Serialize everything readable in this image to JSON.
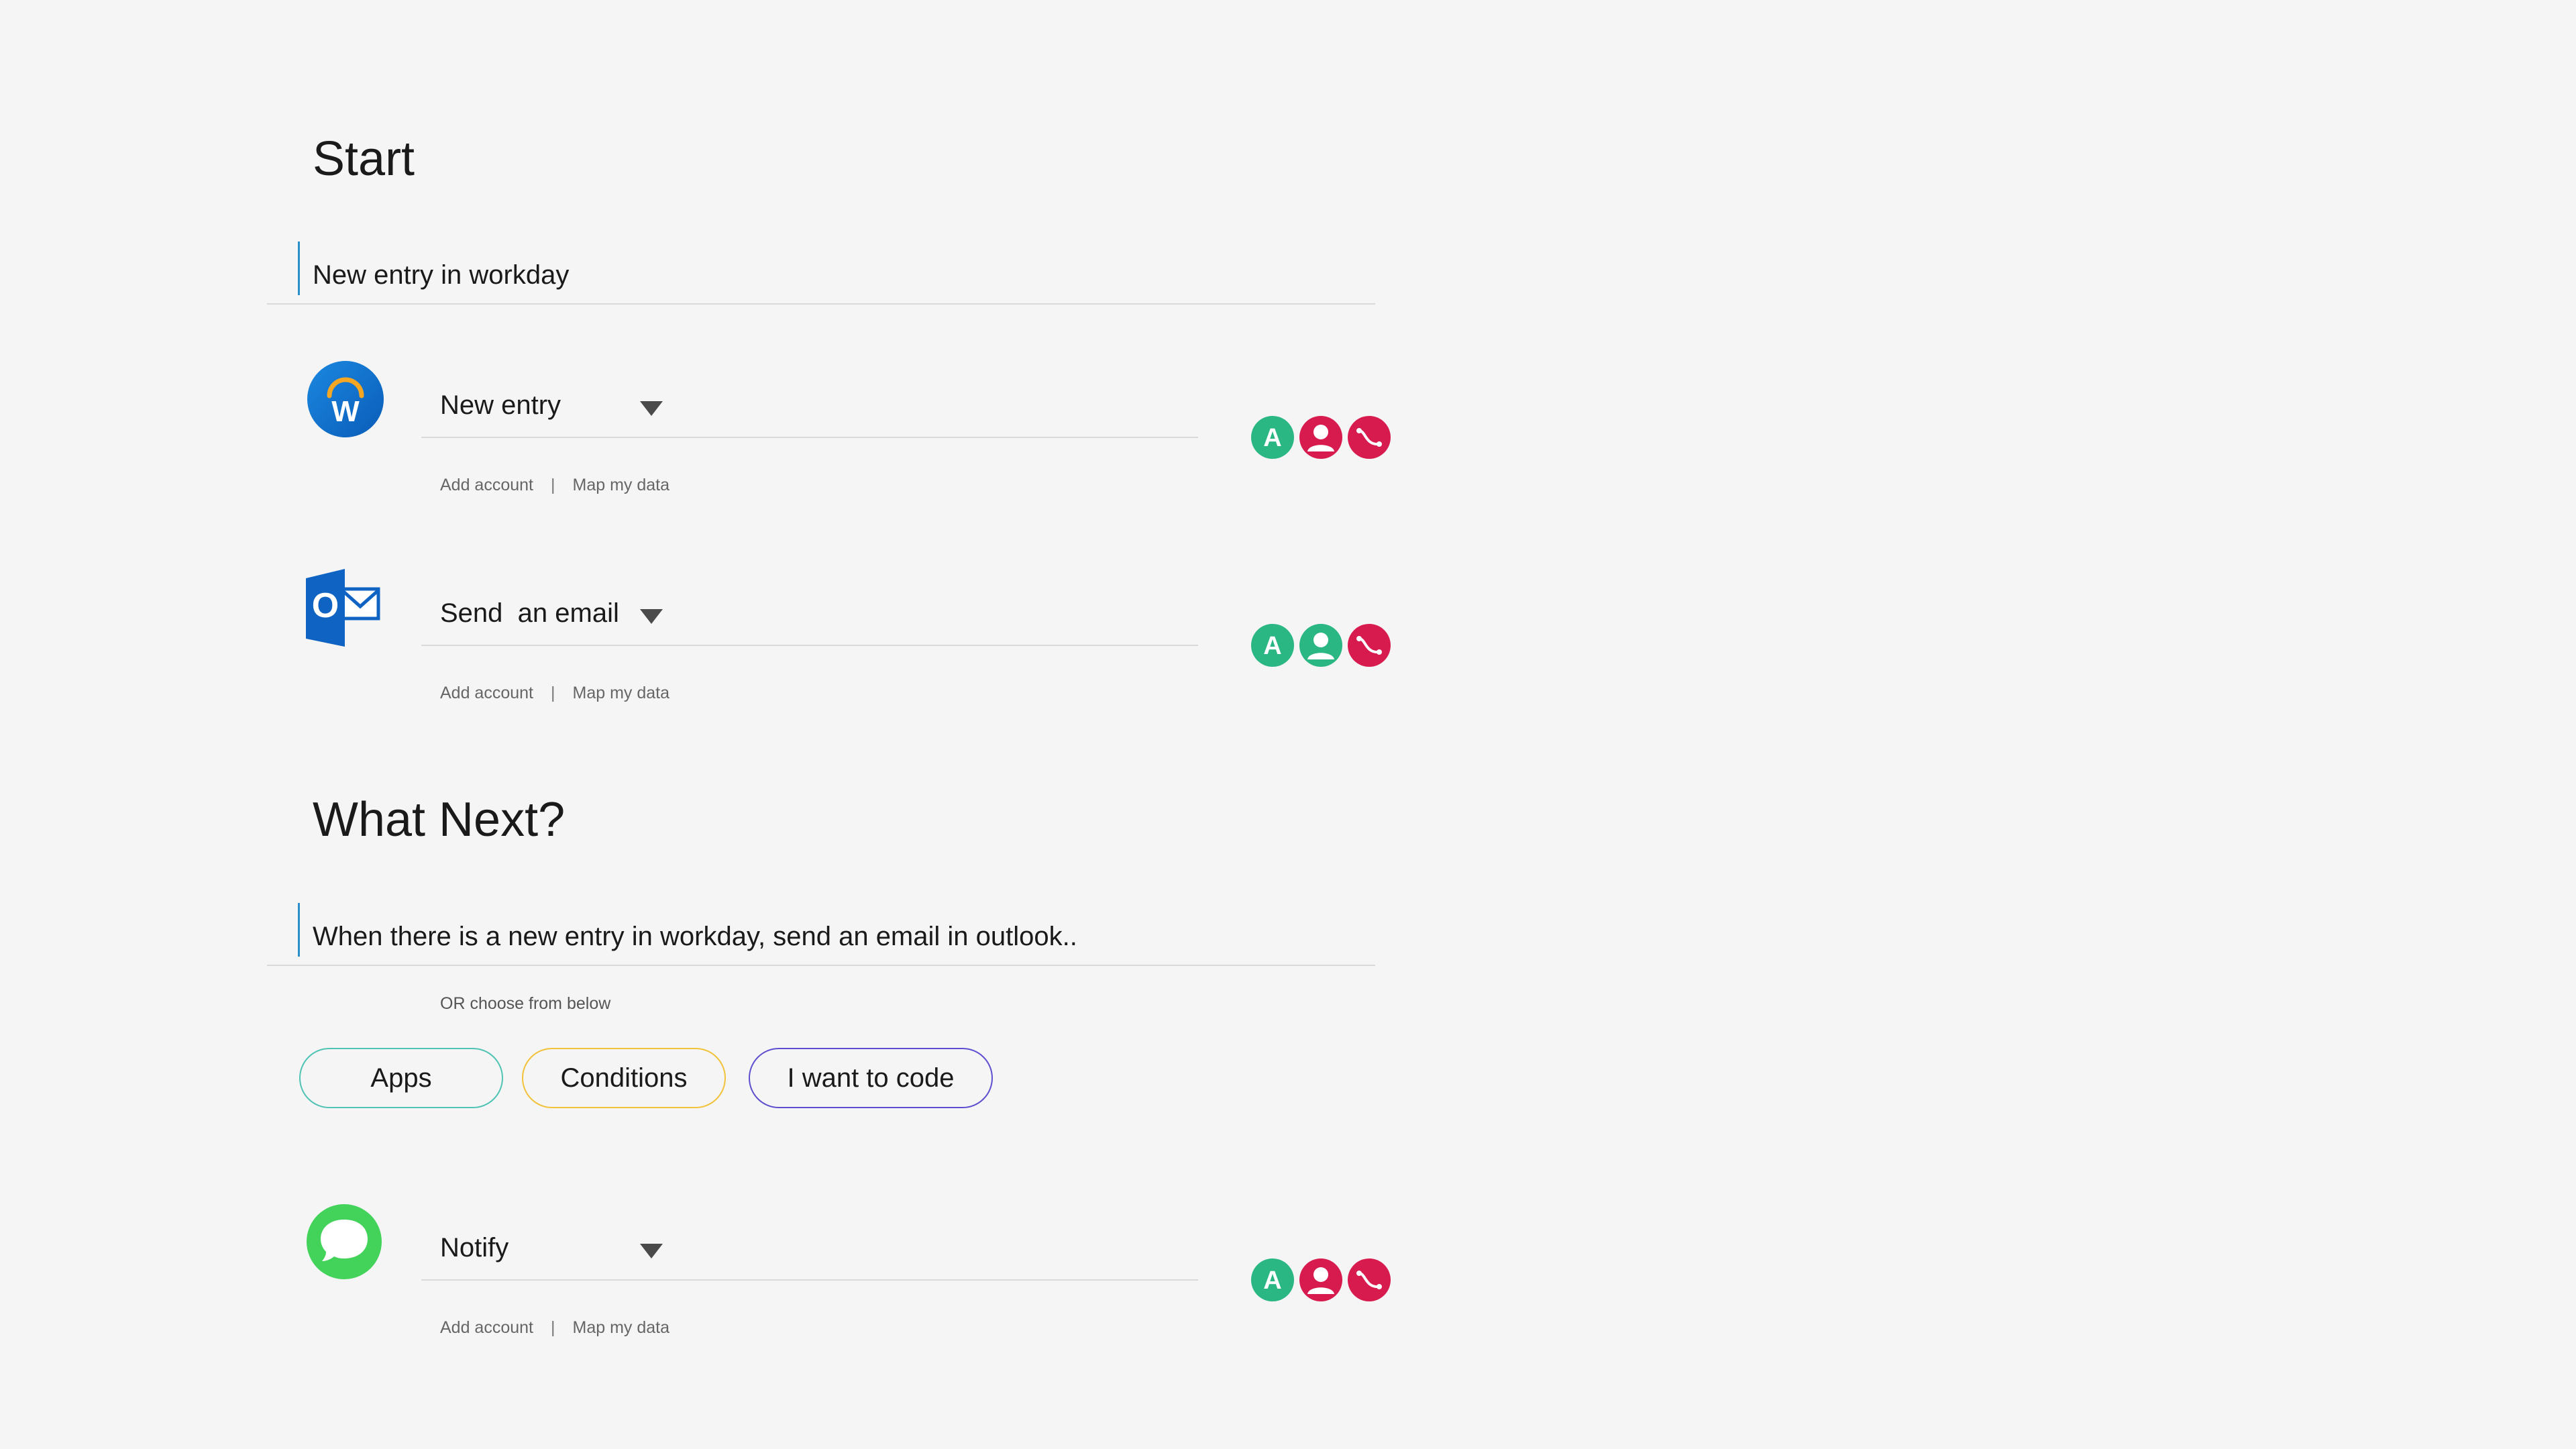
{
  "start": {
    "heading": "Start",
    "prompt": "New entry in workday"
  },
  "steps": [
    {
      "app_icon": "workday-logo-icon",
      "action": "New entry",
      "add_account": "Add account",
      "separator": "|",
      "map_data": "Map my data",
      "status_icons": [
        "account-a-icon",
        "user-icon",
        "route-icon"
      ]
    },
    {
      "app_icon": "outlook-logo-icon",
      "action": "Send  an email",
      "add_account": "Add account",
      "separator": "|",
      "map_data": "Map my data",
      "status_icons": [
        "account-a-icon",
        "user-icon",
        "route-icon"
      ]
    },
    {
      "app_icon": "messages-logo-icon",
      "action": "Notify",
      "add_account": "Add account",
      "separator": "|",
      "map_data": "Map my data",
      "status_icons": [
        "account-a-icon",
        "user-icon",
        "route-icon"
      ]
    }
  ],
  "next": {
    "heading": "What Next?",
    "prompt": "When there is a new entry in workday, send an email in outlook..",
    "hint": "OR choose from below",
    "options": [
      {
        "label": "Apps",
        "color": "#4fc4b4"
      },
      {
        "label": "Conditions",
        "color": "#f2c23a"
      },
      {
        "label": "I want to code",
        "color": "#5e4fd0"
      }
    ]
  },
  "colors": {
    "green": "#2ab784",
    "red": "#d81b4f",
    "workday_blue": "#0d6fcf",
    "outlook_blue": "#0f63c3",
    "messages_green": "#43d25a"
  }
}
